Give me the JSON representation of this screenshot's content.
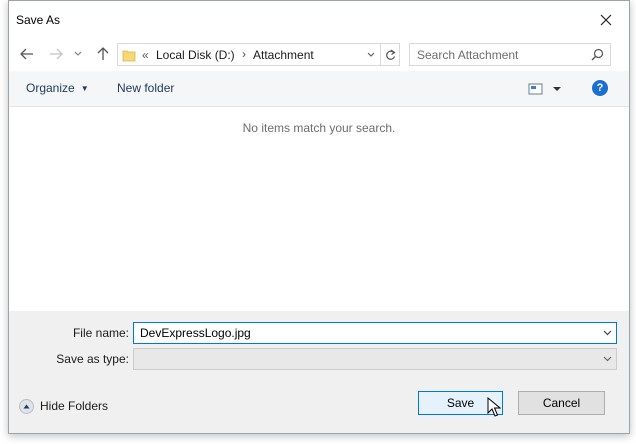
{
  "window": {
    "title": "Save As"
  },
  "address": {
    "overflow": "«",
    "segments": [
      "Local Disk (D:)",
      "Attachment"
    ]
  },
  "search": {
    "placeholder": "Search Attachment"
  },
  "toolbar": {
    "organize_label": "Organize",
    "new_folder_label": "New folder",
    "help_label": "?"
  },
  "content": {
    "empty_message": "No items match your search."
  },
  "form": {
    "file_name_label": "File name:",
    "file_name_value": "DevExpressLogo.jpg",
    "save_as_type_label": "Save as type:",
    "save_as_type_value": ""
  },
  "footer": {
    "hide_folders_label": "Hide Folders",
    "save_label": "Save",
    "cancel_label": "Cancel"
  },
  "colors": {
    "accent": "#0078d7",
    "help": "#1a6fd1",
    "folder": "#f8d775"
  },
  "icons": [
    "close-icon",
    "back-arrow-icon",
    "forward-arrow-icon",
    "recent-chevron-icon",
    "up-arrow-icon",
    "folder-icon",
    "chevron-right-icon",
    "dropdown-icon",
    "refresh-icon",
    "search-icon",
    "view-icon",
    "help-icon",
    "collapse-icon",
    "mouse-cursor-icon"
  ]
}
